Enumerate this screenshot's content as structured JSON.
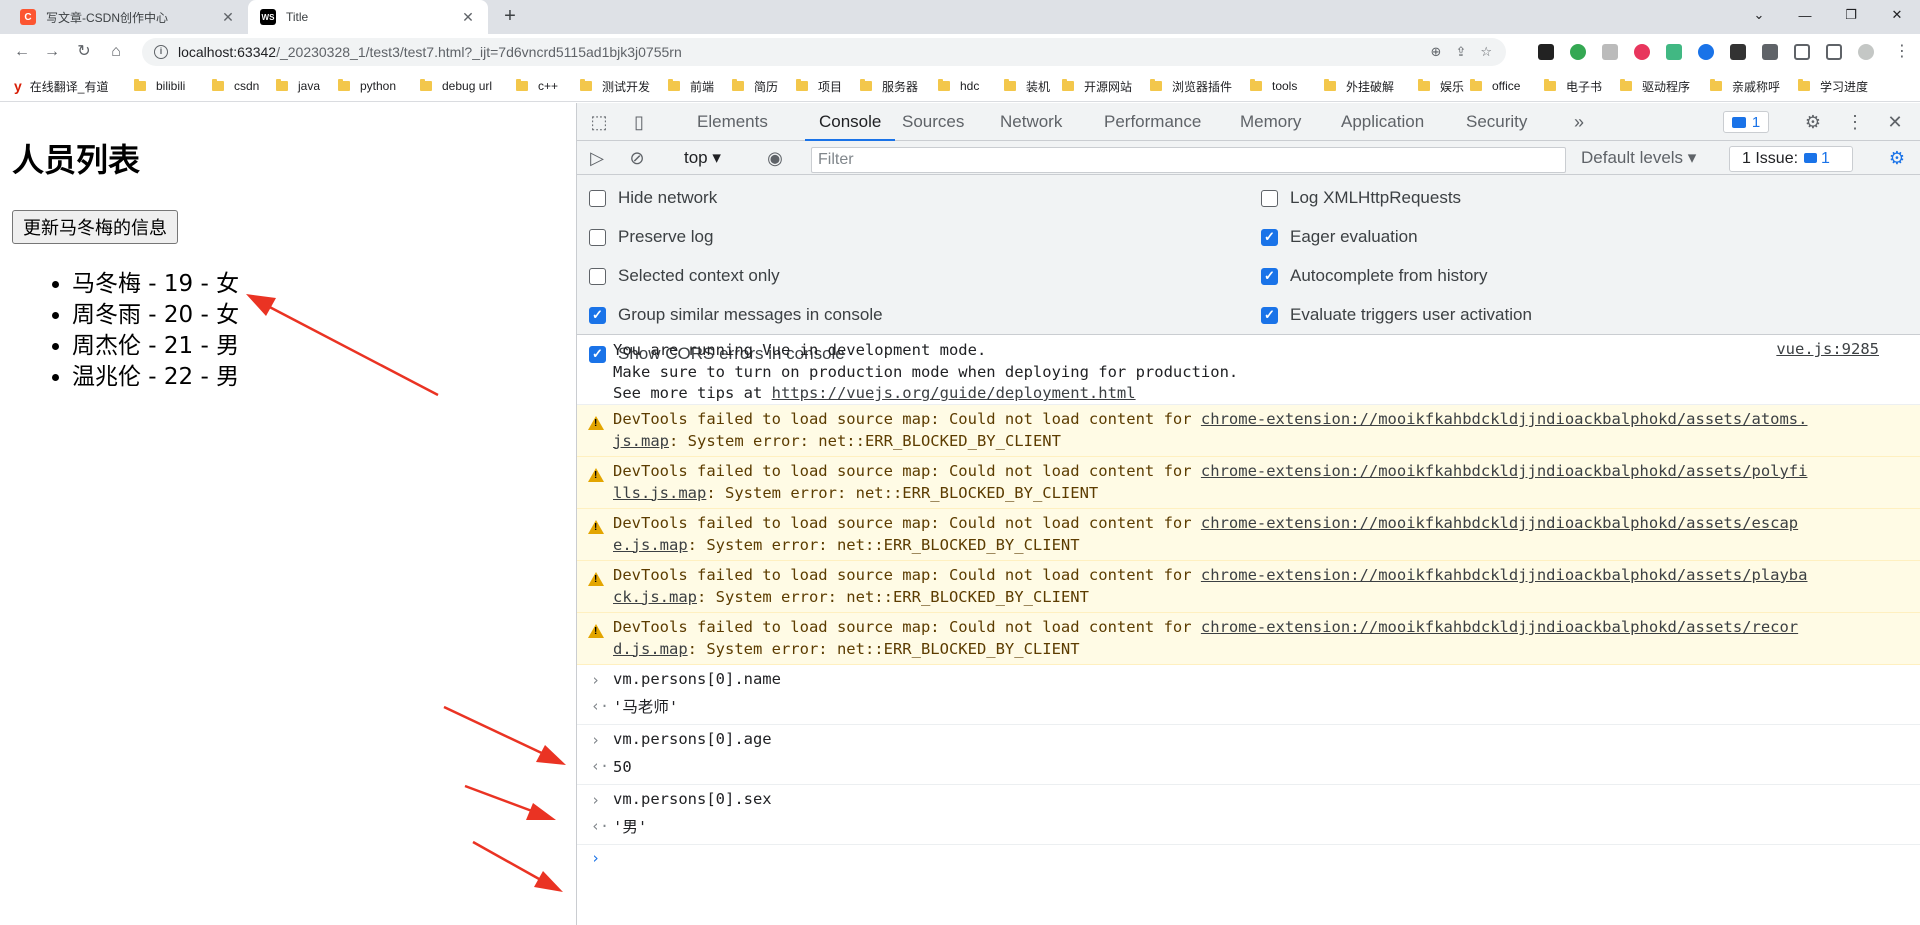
{
  "browser": {
    "tabs": [
      {
        "title": "写文章-CSDN创作中心",
        "favicon": "C"
      },
      {
        "title": "Title",
        "favicon": "WS"
      }
    ],
    "url_host": "localhost:63342",
    "url_path": "/_20230328_1/test3/test7.html?_ijt=7d6vncrd5115ad1bjk3j0755rn",
    "bookmarks": [
      "在线翻译_有道",
      "bilibili",
      "csdn",
      "java",
      "python",
      "debug url",
      "c++",
      "测试开发",
      "前端",
      "简历",
      "项目",
      "服务器",
      "hdc",
      "装机",
      "开源网站",
      "浏览器插件",
      "tools",
      "外挂破解",
      "娱乐",
      "office",
      "电子书",
      "驱动程序",
      "亲戚称呼",
      "学习进度"
    ]
  },
  "page": {
    "heading": "人员列表",
    "update_button": "更新马冬梅的信息",
    "persons": [
      "马冬梅 - 19 - 女",
      "周冬雨 - 20 - 女",
      "周杰伦 - 21 - 男",
      "温兆伦 - 22 - 男"
    ]
  },
  "devtools": {
    "tabs": [
      "Elements",
      "Console",
      "Sources",
      "Network",
      "Performance",
      "Memory",
      "Application",
      "Security"
    ],
    "active_tab": "Console",
    "message_count": "1",
    "context": "top",
    "filter_placeholder": "Filter",
    "levels": "Default levels",
    "issues_label": "1 Issue:",
    "issues_count": "1",
    "settings": {
      "hide_network": "Hide network",
      "preserve_log": "Preserve log",
      "selected_context": "Selected context only",
      "group_similar": "Group similar messages in console",
      "show_cors": "Show CORS errors in console",
      "log_xhr": "Log XMLHttpRequests",
      "eager_eval": "Eager evaluation",
      "autocomplete": "Autocomplete from history",
      "eval_triggers": "Evaluate triggers user activation"
    },
    "console": {
      "vue_line1": "You are running Vue in development mode.",
      "vue_line2": "Make sure to turn on production mode when deploying for production.",
      "vue_line3_prefix": "See more tips at ",
      "vue_line3_link": "https://vuejs.org/guide/deployment.html",
      "vue_source": "vue.js:9285",
      "warn_prefix": "DevTools failed to load source map: Could not load content for ",
      "warn_suffix": ": System error: net::ERR_BLOCKED_BY_CLIENT",
      "warnings": [
        {
          "link_a": "chrome-extension://mooikfkahbdckldjjndioackbalphokd/assets/atoms.",
          "link_b": "js.map"
        },
        {
          "link_a": "chrome-extension://mooikfkahbdckldjjndioackbalphokd/assets/polyfi",
          "link_b": "lls.js.map"
        },
        {
          "link_a": "chrome-extension://mooikfkahbdckldjjndioackbalphokd/assets/escap",
          "link_b": "e.js.map"
        },
        {
          "link_a": "chrome-extension://mooikfkahbdckldjjndioackbalphokd/assets/playba",
          "link_b": "ck.js.map"
        },
        {
          "link_a": "chrome-extension://mooikfkahbdckldjjndioackbalphokd/assets/recor",
          "link_b": "d.js.map"
        }
      ],
      "cmd1": "vm.persons[0].name",
      "res1": "'马老师'",
      "cmd2": "vm.persons[0].age",
      "res2": "50",
      "cmd3": "vm.persons[0].sex",
      "res3": "'男'"
    }
  },
  "colors": {
    "accent": "#1a73e8",
    "annotation_arrow": "#ea3323",
    "warning_bg": "#fffbe5"
  }
}
